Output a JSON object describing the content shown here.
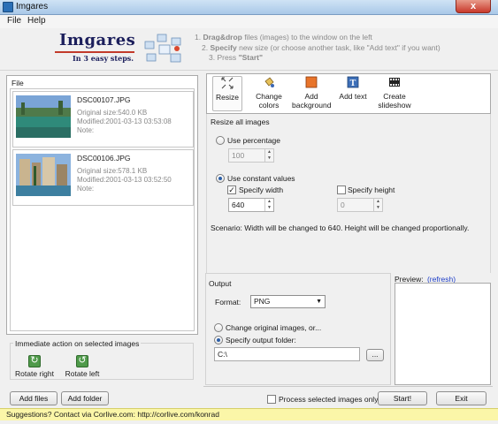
{
  "window": {
    "title": "Imgares",
    "close_glyph": "x"
  },
  "menu": {
    "file": "File",
    "help": "Help"
  },
  "header": {
    "logo": "Imgares",
    "tagline": "In 3 easy steps.",
    "step1_prefix": "1.",
    "step1_bold": "Drag&drop",
    "step1_rest": "files (images)  to the window on the left",
    "step2_prefix": "2.",
    "step2_bold": "Specify",
    "step2_rest": "new size (or choose another task, like \"Add text\" if you want)",
    "step3_prefix": "3. Press",
    "step3_bold": "\"Start\""
  },
  "file_panel": {
    "title": "File",
    "files": [
      {
        "name": "DSC00107.JPG",
        "size": "Original size:540.0 KB",
        "modified": "Modified:2001-03-13 03:53:08",
        "note": "Note:"
      },
      {
        "name": "DSC00106.JPG",
        "size": "Original size:578.1 KB",
        "modified": "Modified:2001-03-13 03:52:50",
        "note": "Note:"
      }
    ]
  },
  "immediate": {
    "title": "Immediate action on selected images",
    "rotate_right": "Rotate right",
    "rotate_left": "Rotate left"
  },
  "buttons": {
    "add_files": "Add files",
    "add_folder": "Add folder",
    "start": "Start!",
    "exit": "Exit",
    "browse": "..."
  },
  "tools": {
    "resize": "Resize",
    "change_colors_1": "Change",
    "change_colors_2": "colors",
    "add_background_1": "Add",
    "add_background_2": "background",
    "add_text": "Add text",
    "create_slideshow_1": "Create",
    "create_slideshow_2": "slideshow"
  },
  "resize": {
    "title": "Resize all images",
    "use_percentage": "Use percentage",
    "percentage_value": "100",
    "use_constant": "Use constant values",
    "specify_width": "Specify width",
    "width_value": "640",
    "specify_height": "Specify height",
    "height_value": "0",
    "scenario": "Scenario: Width will be changed to 640. Height will be changed proportionally."
  },
  "output": {
    "title": "Output",
    "format_label": "Format:",
    "format_value": "PNG",
    "change_original": "Change original images, or...",
    "specify_folder": "Specify output folder:",
    "folder_value": "C:\\",
    "preview_label": "Preview:",
    "refresh": "(refresh)"
  },
  "process_selected": "Process selected images only",
  "suggestions": "Suggestions? Contact via Corlive.com: http://corlive.com/konrad",
  "colors": {
    "accent": "#2c5fa8",
    "suggest_bg": "#fbf6a8",
    "logo": "#1c1f5c"
  }
}
